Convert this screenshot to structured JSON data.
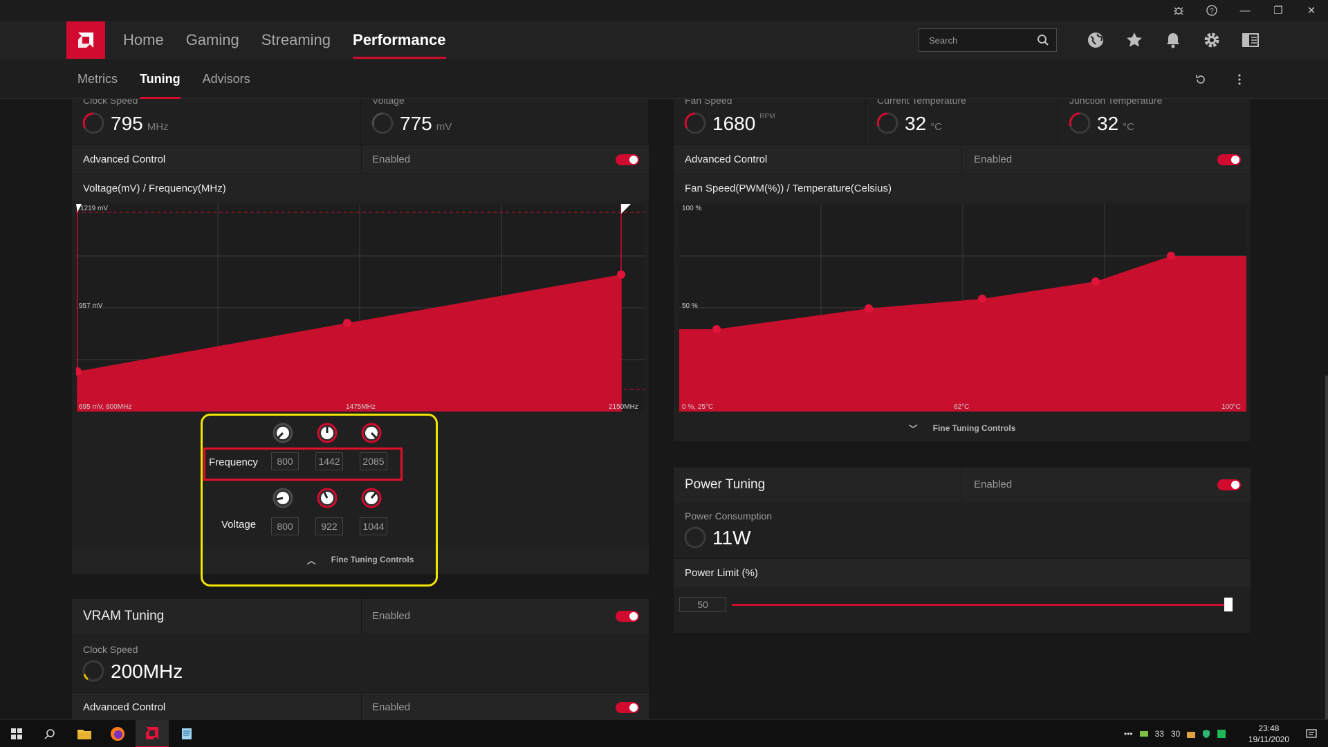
{
  "app": {
    "nav_tabs": [
      "Home",
      "Gaming",
      "Streaming",
      "Performance"
    ],
    "active_nav": "Performance",
    "search_placeholder": "Search",
    "sub_tabs": [
      "Metrics",
      "Tuning",
      "Advisors"
    ],
    "active_sub": "Tuning",
    "accent_color": "#d10a2f"
  },
  "gpu": {
    "stats": [
      {
        "label": "Clock Speed",
        "value": "795",
        "unit": "MHz"
      },
      {
        "label": "Voltage",
        "value": "775",
        "unit": "mV"
      }
    ],
    "advanced_label": "Advanced Control",
    "advanced_state": "Enabled",
    "chart_title": "Voltage(mV) / Frequency(MHz)",
    "chart_labels": {
      "top_left": "1219 mV",
      "mid_left": "957 mV",
      "bottom_left": "695 mV, 800MHz",
      "bottom_mid": "1475MHz",
      "bottom_right": "2150MHz"
    },
    "fine_tuning": {
      "frequency_label": "Frequency",
      "frequency_values": [
        "800",
        "1442",
        "2085"
      ],
      "voltage_label": "Voltage",
      "voltage_values": [
        "800",
        "922",
        "1044"
      ],
      "toggle_label": "Fine Tuning Controls"
    }
  },
  "vram": {
    "title": "VRAM Tuning",
    "state": "Enabled",
    "clock_label": "Clock Speed",
    "clock_value": "200",
    "clock_unit": "MHz",
    "advanced_label": "Advanced Control",
    "advanced_state": "Enabled"
  },
  "fan": {
    "stats": [
      {
        "label": "Fan Speed",
        "value": "1680",
        "unit": "RPM"
      },
      {
        "label": "Current Temperature",
        "value": "32",
        "unit": "°C"
      },
      {
        "label": "Junction Temperature",
        "value": "32",
        "unit": "°C"
      }
    ],
    "advanced_label": "Advanced Control",
    "advanced_state": "Enabled",
    "chart_title": "Fan Speed(PWM(%)) / Temperature(Celsius)",
    "chart_labels": {
      "top_left": "100 %",
      "mid_left": "50 %",
      "bottom_left": "0 %, 25°C",
      "bottom_mid": "62°C",
      "bottom_right": "100°C"
    },
    "fine_tuning_label": "Fine Tuning Controls"
  },
  "power": {
    "title": "Power Tuning",
    "state": "Enabled",
    "consumption_label": "Power Consumption",
    "consumption_value": "11",
    "consumption_unit": "W",
    "limit_label": "Power Limit (%)",
    "limit_value": "50",
    "limit_fraction": 1.0
  },
  "taskbar": {
    "tray_numbers": [
      "33",
      "30"
    ],
    "time": "23:48",
    "date": "19/11/2020"
  }
}
